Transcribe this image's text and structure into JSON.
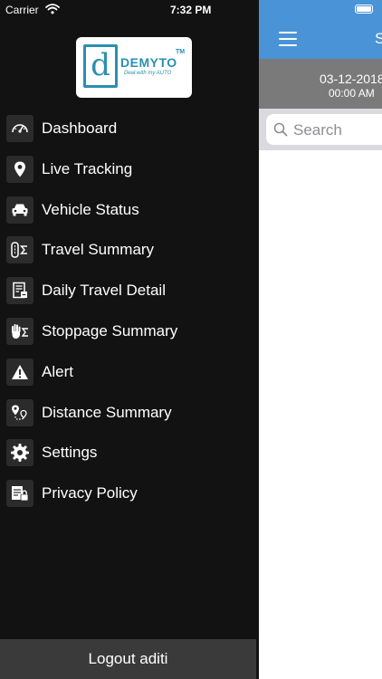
{
  "status_bar": {
    "carrier": "Carrier",
    "time": "7:32 PM"
  },
  "logo": {
    "letter": "d",
    "wordmark": "DEMYTO",
    "trademark": "TM",
    "tagline": "Deal with my AUTO"
  },
  "menu": {
    "items": [
      {
        "label": "Dashboard",
        "icon": "speedometer-icon"
      },
      {
        "label": "Live Tracking",
        "icon": "map-pin-icon"
      },
      {
        "label": "Vehicle Status",
        "icon": "car-icon"
      },
      {
        "label": "Travel Summary",
        "icon": "route-sum-icon"
      },
      {
        "label": "Daily Travel Detail",
        "icon": "document-icon"
      },
      {
        "label": "Stoppage Summary",
        "icon": "hand-sum-icon"
      },
      {
        "label": "Alert",
        "icon": "warning-icon"
      },
      {
        "label": "Distance Summary",
        "icon": "distance-pins-icon"
      },
      {
        "label": "Settings",
        "icon": "gear-icon"
      },
      {
        "label": "Privacy Policy",
        "icon": "policy-lock-icon"
      }
    ]
  },
  "logout": {
    "label": "Logout aditi"
  },
  "background_screen": {
    "title_partial": "S",
    "date": "03-12-2018",
    "time": "00:00 AM",
    "search_placeholder": "Search"
  },
  "colors": {
    "drawer_bg": "#121212",
    "nav_bar": "#4a93d6",
    "logo_blue": "#2a8fb0",
    "logout_bg": "#3a3a3a",
    "date_bar": "#7a7a7a"
  }
}
